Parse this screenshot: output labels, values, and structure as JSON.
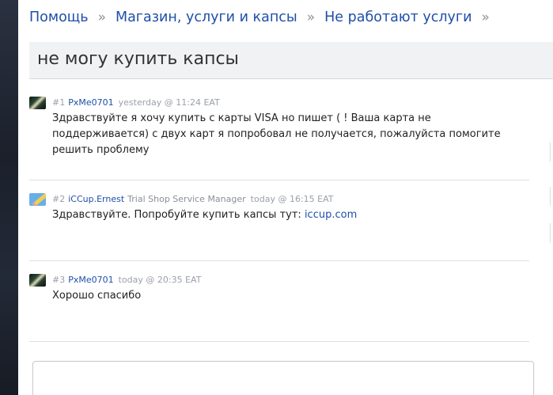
{
  "breadcrumb": {
    "items": [
      "Помощь",
      "Магазин, услуги и капсы",
      "Не работают услуги"
    ],
    "separator": "»"
  },
  "thread": {
    "title": "не могу купить капсы"
  },
  "posts": [
    {
      "num": "#1",
      "user": "PxMe0701",
      "role": "",
      "time": "yesterday @ 11:24 EAT",
      "text": "Здравствуйте я хочу купить с карты VISA но пишет ( ! Ваша карта не поддерживается) с двух карт я попробовал не получается, пожалуйста помогите решить проблему"
    },
    {
      "num": "#2",
      "user": "iCCup.Ernest",
      "role": "Trial Shop Service Manager",
      "time": "today @ 16:15 EAT",
      "text": "Здравствуйте. Попробуйте купить капсы тут: ",
      "link": "iccup.com"
    },
    {
      "num": "#3",
      "user": "PxMe0701",
      "role": "",
      "time": "today @ 20:35 EAT",
      "text": "Хорошо спасибо"
    }
  ],
  "icons": {
    "avatar_1": "user-avatar-icon",
    "avatar_2": "moderator-pencil-avatar-icon",
    "avatar_3": "user-avatar-icon"
  },
  "colors": {
    "link": "#1f4fa8",
    "meta": "#9aa0aa",
    "title_bg": "#f1f2f4"
  }
}
